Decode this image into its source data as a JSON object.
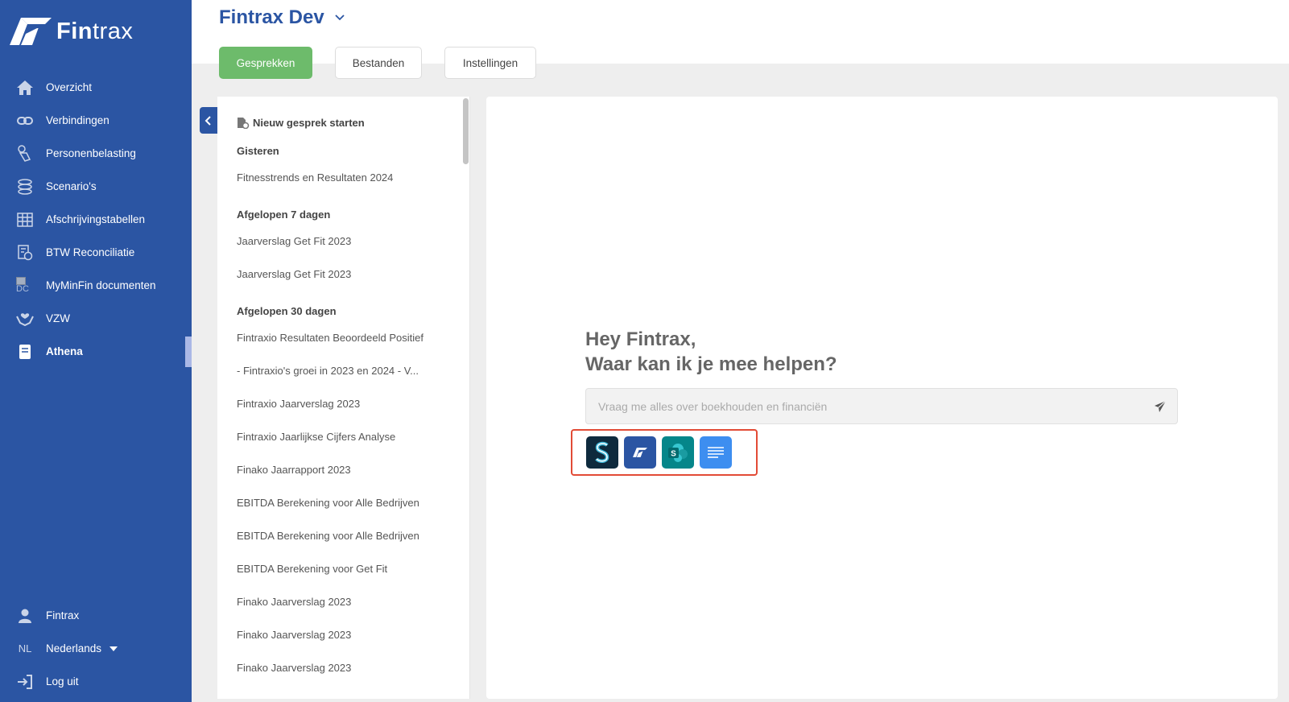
{
  "brand": {
    "name_bold": "Fin",
    "name_rest": "trax"
  },
  "sidebar": {
    "items": [
      {
        "label": "Overzicht",
        "icon": "home-icon"
      },
      {
        "label": "Verbindingen",
        "icon": "link-icon"
      },
      {
        "label": "Personenbelasting",
        "icon": "hand-coin-icon"
      },
      {
        "label": "Scenario's",
        "icon": "coins-icon"
      },
      {
        "label": "Afschrijvingstabellen",
        "icon": "table-icon"
      },
      {
        "label": "BTW Reconciliatie",
        "icon": "tax-icon"
      },
      {
        "label": "MyMinFin documenten",
        "icon": "broken-image-icon",
        "icon_text": "DC"
      },
      {
        "label": "VZW",
        "icon": "hands-heart-icon"
      },
      {
        "label": "Athena",
        "icon": "book-icon",
        "active": true
      }
    ],
    "bottom": {
      "user": "Fintrax",
      "language_code": "NL",
      "language": "Nederlands",
      "logout": "Log uit"
    }
  },
  "header": {
    "title": "Fintrax Dev",
    "tabs": [
      {
        "label": "Gesprekken",
        "active": true
      },
      {
        "label": "Bestanden",
        "active": false
      },
      {
        "label": "Instellingen",
        "active": false
      }
    ]
  },
  "history": {
    "new_chat_label": "Nieuw gesprek starten",
    "groups": [
      {
        "title": "Gisteren",
        "items": [
          "Fitnesstrends en Resultaten 2024"
        ]
      },
      {
        "title": "Afgelopen 7 dagen",
        "items": [
          "Jaarverslag Get Fit 2023",
          "Jaarverslag Get Fit 2023"
        ]
      },
      {
        "title": "Afgelopen 30 dagen",
        "items": [
          "Fintraxio Resultaten Beoordeeld Positief",
          "- Fintraxio's groei in 2023 en 2024 - V...",
          "Fintraxio Jaarverslag 2023",
          "Fintraxio Jaarlijkse Cijfers Analyse",
          "Finako Jaarrapport 2023",
          "EBITDA Berekening voor Alle Bedrijven",
          "EBITDA Berekening voor Alle Bedrijven",
          "EBITDA Berekening voor Get Fit",
          "Finako Jaarverslag 2023",
          "Finako Jaarverslag 2023",
          "Finako Jaarverslag 2023"
        ]
      }
    ]
  },
  "chat": {
    "greeting_line1": "Hey Fintrax,",
    "greeting_line2": "Waar kan ik je mee helpen?",
    "input_placeholder": "Vraag me alles over boekhouden en financiën",
    "input_value": "",
    "sources": [
      {
        "name": "s-app-icon",
        "color": "#0e2a3d"
      },
      {
        "name": "fintrax-icon",
        "color": "#2b55a3"
      },
      {
        "name": "sharepoint-icon",
        "color": "#05868a"
      },
      {
        "name": "document-icon",
        "color": "#3d8ef0"
      }
    ]
  },
  "colors": {
    "sidebar": "#2b55a3",
    "accent_green": "#6dbb6b",
    "highlight_red": "#e24b36"
  }
}
